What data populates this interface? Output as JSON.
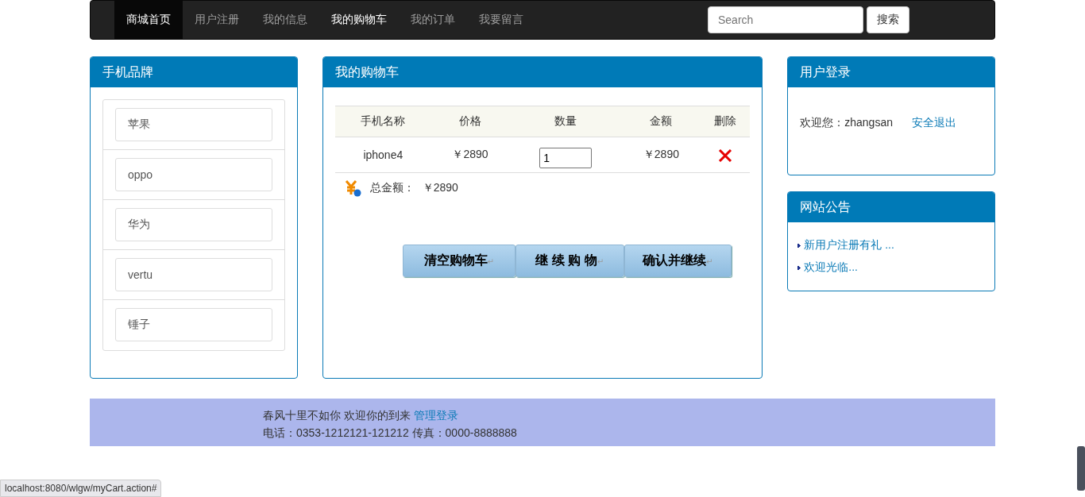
{
  "navbar": {
    "items": [
      {
        "label": "商城首页",
        "selected": true,
        "current": false
      },
      {
        "label": "用户注册",
        "selected": false,
        "current": false
      },
      {
        "label": "我的信息",
        "selected": false,
        "current": false
      },
      {
        "label": "我的购物车",
        "selected": false,
        "current": true
      },
      {
        "label": "我的订单",
        "selected": false,
        "current": false
      },
      {
        "label": "我要留言",
        "selected": false,
        "current": false
      }
    ],
    "search": {
      "placeholder": "Search"
    },
    "search_button": "搜索"
  },
  "brands": {
    "title": "手机品牌",
    "items": [
      "苹果",
      "oppo",
      "华为",
      "vertu",
      "锤子"
    ]
  },
  "cart": {
    "title": "我的购物车",
    "columns": [
      "手机名称",
      "价格",
      "数量",
      "金额",
      "删除"
    ],
    "rows": [
      {
        "name": "iphone4",
        "price": "￥2890",
        "quantity": "1",
        "amount": "￥2890"
      }
    ],
    "total_label": "总金额：",
    "total": "￥2890",
    "buttons": [
      {
        "label": "清空购物车",
        "mark": "↵"
      },
      {
        "label": "继 续 购 物",
        "mark": "↵"
      },
      {
        "label": "确认并继续",
        "mark": "↵"
      }
    ]
  },
  "login": {
    "title": "用户登录",
    "welcome": "欢迎您：zhangsan",
    "logout": "安全退出"
  },
  "notices": {
    "title": "网站公告",
    "items": [
      "新用户注册有礼 ...",
      "欢迎光临..."
    ]
  },
  "footer": {
    "line1": "春风十里不如你 欢迎你的到来",
    "admin_link": "管理登录",
    "line2": "电话：0353-1212121-121212 传真：0000-8888888"
  },
  "status_bar": "localhost:8080/wlgw/myCart.action#"
}
